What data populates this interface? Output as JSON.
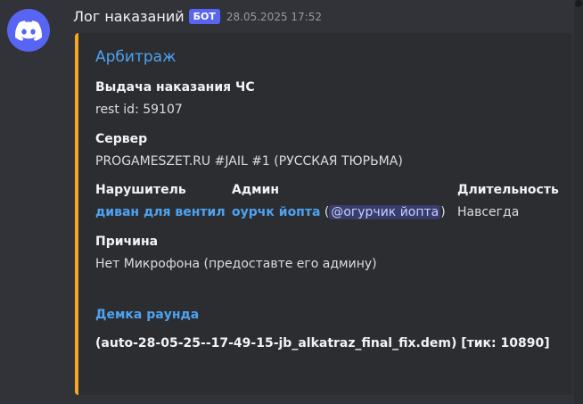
{
  "message": {
    "author": "Лог наказаний",
    "bot_tag": "БОТ",
    "timestamp": "28.05.2025 17:52",
    "avatar_icon": "discord-logo-icon"
  },
  "embed": {
    "accent_color": "#f5a623",
    "title": "Арбитраж",
    "punishment": {
      "name": "Выдача наказания ЧС",
      "value": "rest id: 59107"
    },
    "server": {
      "name": "Сервер",
      "value": "PROGAMESZET.RU #JAIL #1 (РУССКАЯ ТЮРЬМА)"
    },
    "offender": {
      "name": "Нарушитель",
      "value": "диван для вентил"
    },
    "admin": {
      "name": "Админ",
      "value": "оурчк йопта",
      "open_paren": "(",
      "mention": "@огурчик йопта",
      "close_paren": ")"
    },
    "duration": {
      "name": "Длительность",
      "value": "Навсегда"
    },
    "reason": {
      "name": "Причина",
      "value": "Нет Микрофона (предоставте его админу)"
    },
    "demo": {
      "title": "Демка раунда",
      "file": "(auto-28-05-25--17-49-15-jb_alkatraz_final_fix.dem) [тик: 10890]"
    }
  }
}
